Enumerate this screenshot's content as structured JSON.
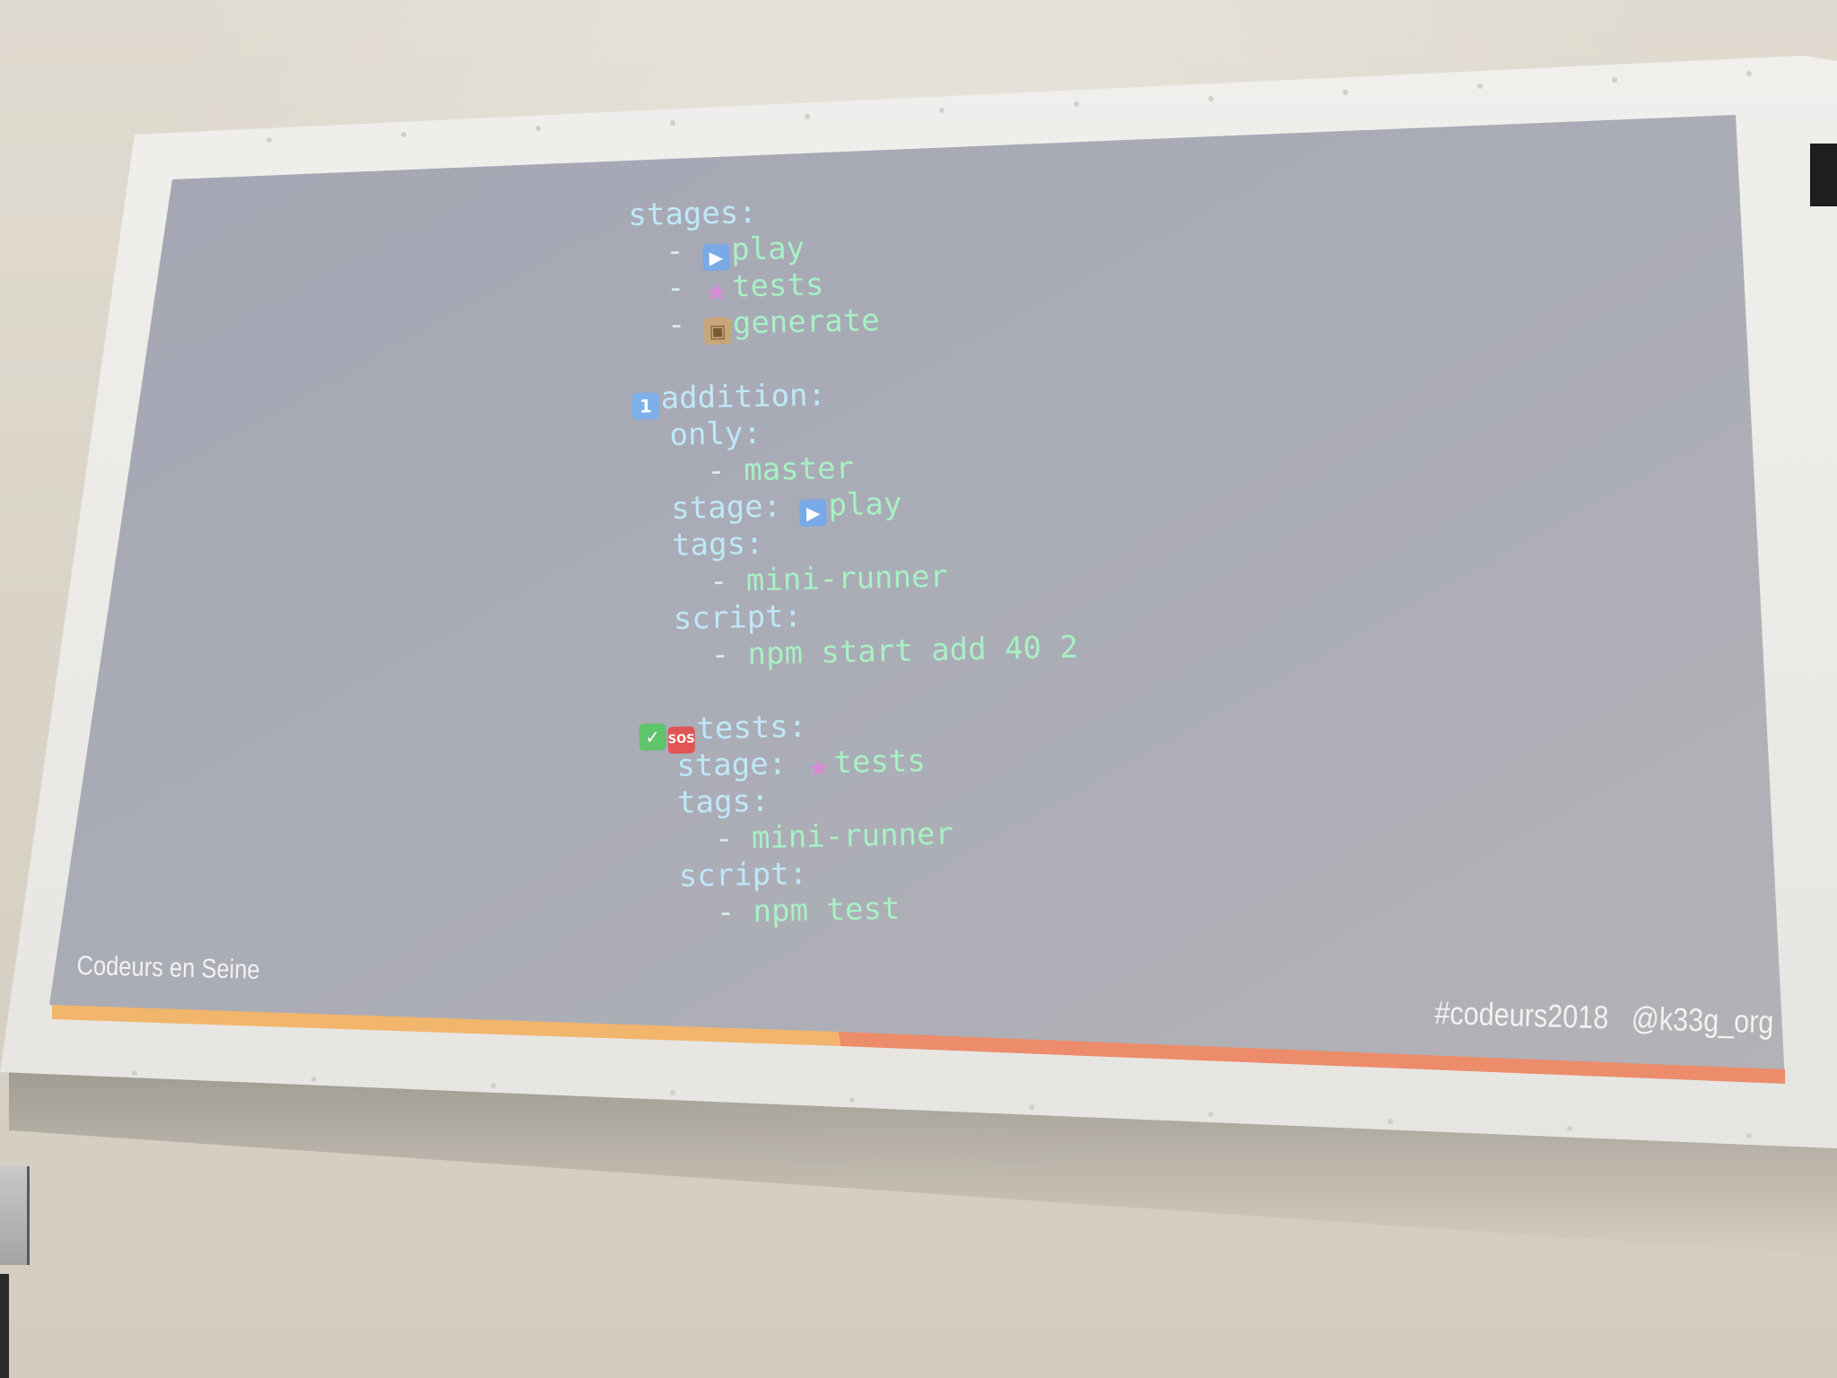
{
  "slide": {
    "code_lines": [
      {
        "indent": "",
        "emoji": "",
        "key": "stages:",
        "val": ""
      },
      {
        "indent": "  ",
        "dash": "- ",
        "emoji": "play",
        "key": "",
        "val": "play"
      },
      {
        "indent": "  ",
        "dash": "- ",
        "emoji": "unicorn",
        "key": "",
        "val": "tests"
      },
      {
        "indent": "  ",
        "dash": "- ",
        "emoji": "box",
        "key": "",
        "val": "generate"
      },
      {
        "indent": "",
        "emoji": "",
        "key": "",
        "val": ""
      },
      {
        "indent": "",
        "emoji": "one",
        "key": "addition:",
        "val": ""
      },
      {
        "indent": "  ",
        "emoji": "",
        "key": "only:",
        "val": ""
      },
      {
        "indent": "    ",
        "dash": "- ",
        "emoji": "",
        "key": "",
        "val": "master"
      },
      {
        "indent": "  ",
        "emoji": "",
        "key": "stage: ",
        "val": "play",
        "val_emoji": "play"
      },
      {
        "indent": "  ",
        "emoji": "",
        "key": "tags:",
        "val": ""
      },
      {
        "indent": "    ",
        "dash": "- ",
        "emoji": "",
        "key": "",
        "val": "mini-runner"
      },
      {
        "indent": "  ",
        "emoji": "",
        "key": "script:",
        "val": ""
      },
      {
        "indent": "    ",
        "dash": "- ",
        "emoji": "",
        "key": "",
        "val": "npm start add 40 2"
      },
      {
        "indent": "",
        "emoji": "",
        "key": "",
        "val": ""
      },
      {
        "indent": "",
        "emoji": "check-sos",
        "key": "tests:",
        "val": ""
      },
      {
        "indent": "  ",
        "emoji": "",
        "key": "stage: ",
        "val": "tests",
        "val_emoji": "unicorn"
      },
      {
        "indent": "  ",
        "emoji": "",
        "key": "tags:",
        "val": ""
      },
      {
        "indent": "    ",
        "dash": "- ",
        "emoji": "",
        "key": "",
        "val": "mini-runner"
      },
      {
        "indent": "  ",
        "emoji": "",
        "key": "script:",
        "val": ""
      },
      {
        "indent": "    ",
        "dash": "- ",
        "emoji": "",
        "key": "",
        "val": "npm test"
      }
    ],
    "footer_left": "Codeurs en Seine",
    "footer_hashtag": "#codeurs2018",
    "footer_handle": "@k33g_org",
    "colors": {
      "slide_bg": "#a9abb6",
      "key": "#bfe7f8",
      "value": "#a8f0c4",
      "bar_left": "#f0b36a",
      "bar_right": "#ee8a6a"
    },
    "icons": {
      "play": "play-button-icon",
      "unicorn": "unicorn-icon",
      "box": "package-icon",
      "one": "keycap-one-icon",
      "check": "check-mark-icon",
      "sos": "sos-icon"
    }
  }
}
